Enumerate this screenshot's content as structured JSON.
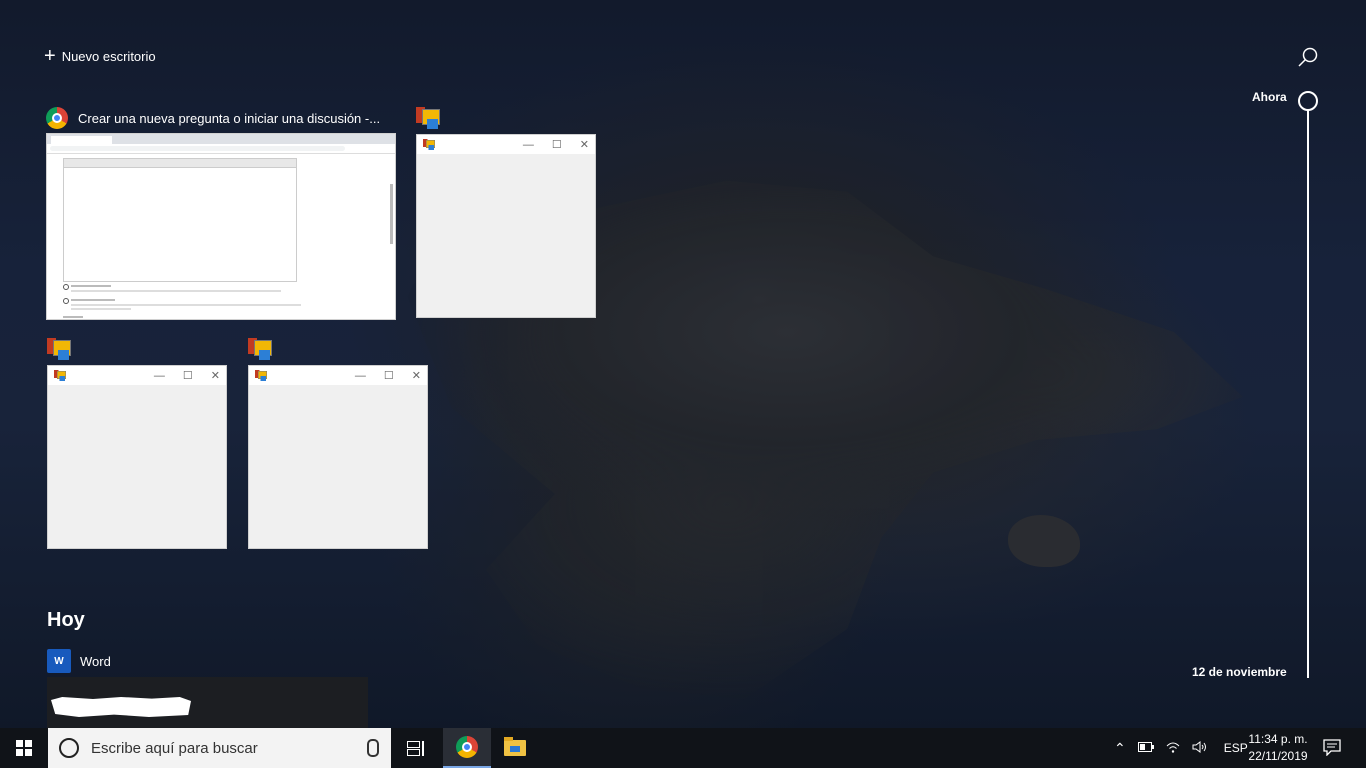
{
  "top": {
    "new_desktop_label": "Nuevo escritorio"
  },
  "timeline": {
    "now_label": "Ahora",
    "date_label": "12 de noviembre"
  },
  "windows": [
    {
      "title": "Crear una nueva pregunta o iniciar una discusión -...",
      "app": "chrome-icon"
    },
    {
      "title": "",
      "app": "paint-app-icon"
    },
    {
      "title": "",
      "app": "paint-app-icon"
    },
    {
      "title": "",
      "app": "paint-app-icon"
    }
  ],
  "thumb_controls": {
    "minimize": "—",
    "maximize": "☐",
    "close": "✕"
  },
  "activity": {
    "section_title": "Hoy",
    "app_label": "Word",
    "word_icon_letter": "W"
  },
  "taskbar": {
    "search_placeholder": "Escribe aquí para buscar",
    "language": "ESP",
    "time": "11:34 p. m.",
    "date": "22/11/2019"
  }
}
